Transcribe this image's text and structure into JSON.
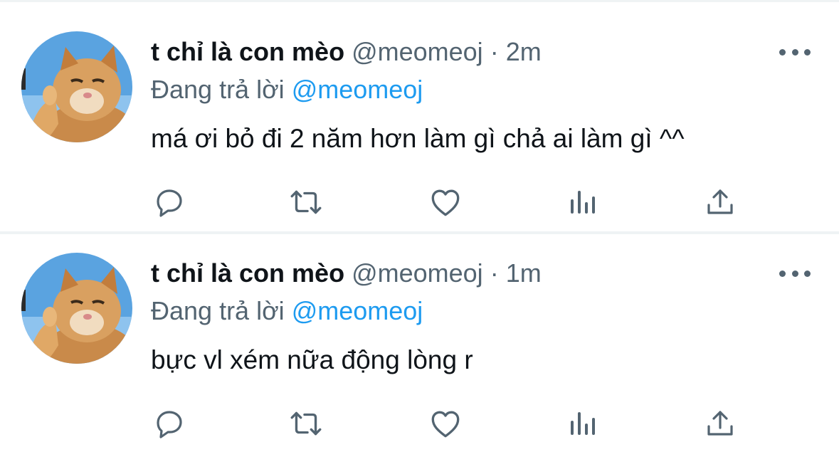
{
  "tweets": [
    {
      "name": "t chỉ là con mèo",
      "handle": "@meomeoj",
      "separator": "·",
      "time": "2m",
      "replying_prefix": "Đang trả lời",
      "replying_to": "@meomeoj",
      "text": "má ơi bỏ đi 2 năm hơn làm gì chả ai làm gì ^^",
      "actions": [
        "reply-icon",
        "retweet-icon",
        "like-icon",
        "views-icon",
        "share-icon"
      ]
    },
    {
      "name": "t chỉ là con mèo",
      "handle": "@meomeoj",
      "separator": "·",
      "time": "1m",
      "replying_prefix": "Đang trả lời",
      "replying_to": "@meomeoj",
      "text": "bực vl xém nữa động lòng r",
      "actions": [
        "reply-icon",
        "retweet-icon",
        "like-icon",
        "views-icon",
        "share-icon"
      ]
    }
  ],
  "colors": {
    "text_primary": "#0f1419",
    "text_secondary": "#536471",
    "accent": "#1d9bf0",
    "divider": "#eff3f4"
  }
}
